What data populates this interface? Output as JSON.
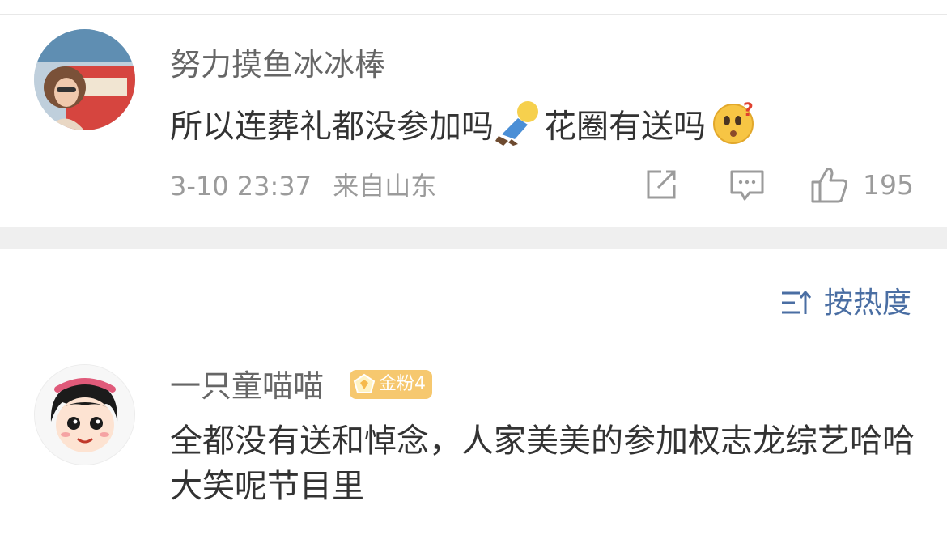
{
  "comments": [
    {
      "username": "努力摸鱼冰冰棒",
      "text_before": "所以连葬礼都没参加吗",
      "text_middle": "花圈有送吗",
      "emoji_1": "lying-person-emoji",
      "emoji_2": "confused-face-emoji",
      "date": "3-10 23:37",
      "location": "来自山东",
      "likes": "195"
    },
    {
      "username": "一只童喵喵",
      "badge": "金粉4",
      "text": "全都没有送和悼念，人家美美的参加权志龙综艺哈哈大笑呢节目里"
    }
  ],
  "sort": {
    "label": "按热度",
    "icon": "sort-icon"
  },
  "colors": {
    "link": "#4a6ea3",
    "badge": "#f6c86f",
    "meta": "#9b9b9b"
  }
}
